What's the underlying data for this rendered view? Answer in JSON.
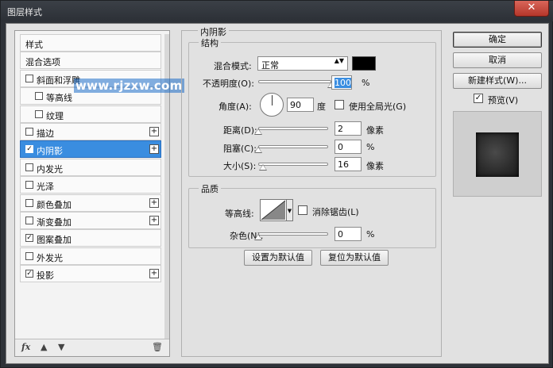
{
  "window": {
    "title": "图层样式",
    "close_glyph": "✕"
  },
  "watermark": "www.rjzxw.com",
  "styles_list": [
    {
      "label": "样式",
      "type": "header"
    },
    {
      "label": "混合选项",
      "type": "header"
    },
    {
      "label": "斜面和浮雕",
      "checked": false,
      "indent": 0
    },
    {
      "label": "等高线",
      "checked": false,
      "indent": 1
    },
    {
      "label": "纹理",
      "checked": false,
      "indent": 1
    },
    {
      "label": "描边",
      "checked": false,
      "indent": 0,
      "plus": true
    },
    {
      "label": "内阴影",
      "checked": true,
      "indent": 0,
      "plus": true,
      "selected": true
    },
    {
      "label": "内发光",
      "checked": false,
      "indent": 0
    },
    {
      "label": "光泽",
      "checked": false,
      "indent": 0
    },
    {
      "label": "颜色叠加",
      "checked": false,
      "indent": 0,
      "plus": true
    },
    {
      "label": "渐变叠加",
      "checked": false,
      "indent": 0,
      "plus": true
    },
    {
      "label": "图案叠加",
      "checked": true,
      "indent": 0
    },
    {
      "label": "外发光",
      "checked": false,
      "indent": 0
    },
    {
      "label": "投影",
      "checked": true,
      "indent": 0,
      "plus": true
    }
  ],
  "footer": {
    "fx": "fx",
    "up_icon": "▲",
    "down_icon": "▼",
    "trash_icon": "🗑"
  },
  "inner_shadow": {
    "section_title": "内阴影",
    "structure": {
      "title": "结构",
      "blend_mode_label": "混合模式:",
      "blend_mode_value": "正常",
      "select_arrows": "▲▼",
      "color": "#000000",
      "opacity_label": "不透明度(O):",
      "opacity_value": "100",
      "opacity_unit": "%",
      "opacity_fraction": 1.0,
      "angle_label": "角度(A):",
      "angle_value": "90",
      "angle_unit": "度",
      "use_global_light_label": "使用全局光(G)",
      "use_global_light_checked": false,
      "distance_label": "距离(D):",
      "distance_value": "2",
      "distance_unit": "像素",
      "distance_fraction": 0.0,
      "choke_label": "阻塞(C):",
      "choke_value": "0",
      "choke_unit": "%",
      "choke_fraction": 0.0,
      "size_label": "大小(S):",
      "size_value": "16",
      "size_unit": "像素",
      "size_fraction": 0.07
    },
    "quality": {
      "title": "品质",
      "contour_label": "等高线:",
      "anti_alias_label": "消除锯齿(L)",
      "anti_alias_checked": false,
      "noise_label": "杂色(N):",
      "noise_value": "0",
      "noise_unit": "%",
      "noise_fraction": 0.0
    },
    "set_default_label": "设置为默认值",
    "reset_default_label": "复位为默认值"
  },
  "buttons": {
    "ok": "确定",
    "cancel": "取消",
    "new_style": "新建样式(W)...",
    "preview_label": "预览(V)",
    "preview_checked": true
  },
  "checkmark": "✓"
}
